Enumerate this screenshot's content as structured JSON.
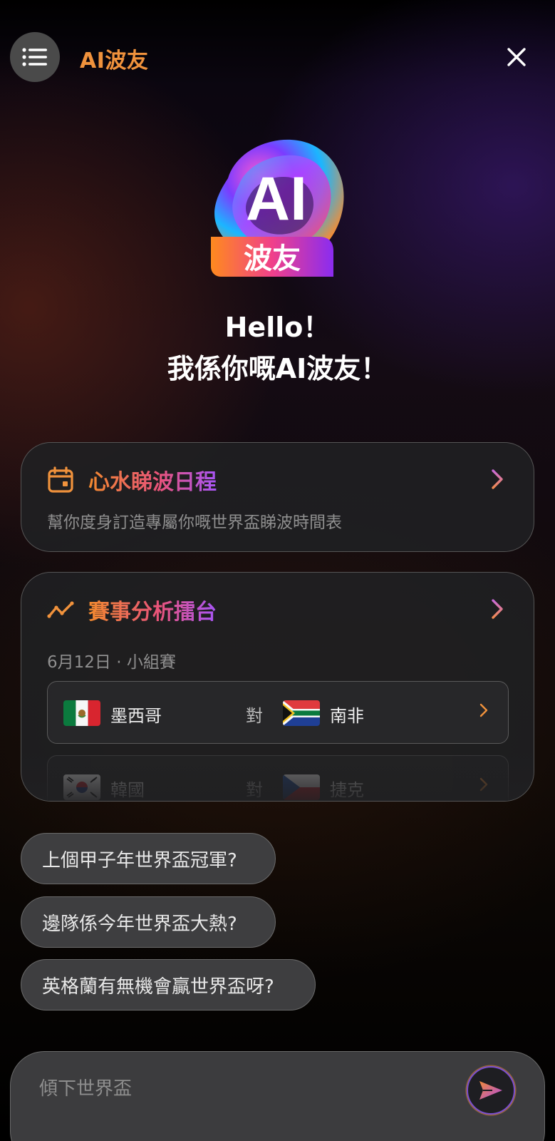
{
  "header": {
    "title": "AI波友",
    "menu_icon": "list-menu-icon",
    "close_icon": "close-icon"
  },
  "logo": {
    "top_text": "AI",
    "badge_text": "波友"
  },
  "greeting": {
    "line1": "Hello！",
    "line2": "我係你嘅AI波友！"
  },
  "schedule_card": {
    "icon": "calendar-icon",
    "title": "心水睇波日程",
    "subtitle": "幫你度身訂造專屬你嘅世界盃睇波時間表"
  },
  "arena_card": {
    "icon": "trend-line-icon",
    "title": "賽事分析擂台",
    "date_line": "6月12日 · 小組賽",
    "vs_label": "對",
    "matches": [
      {
        "team_a": "墨西哥",
        "flag_a": "mexico-flag",
        "team_b": "南非",
        "flag_b": "south-africa-flag"
      },
      {
        "team_a": "韓國",
        "flag_a": "south-korea-flag",
        "team_b": "捷克",
        "flag_b": "czech-flag"
      }
    ]
  },
  "suggestions": [
    "上個甲子年世界盃冠軍?",
    "邊隊係今年世界盃大熱?",
    "英格蘭有無機會贏世界盃呀?"
  ],
  "input": {
    "placeholder": "傾下世界盃",
    "value": "",
    "send_icon": "send-icon"
  },
  "colors": {
    "accent_orange": "#f0923c",
    "gradient_pink": "#e8537a",
    "gradient_purple": "#a855f7"
  }
}
